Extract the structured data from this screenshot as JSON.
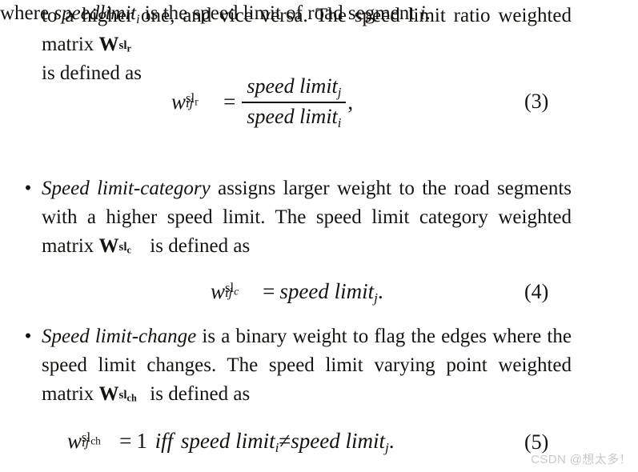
{
  "document": {
    "type": "academic-paper-excerpt",
    "background_color": "#ffffff",
    "text_color": "#15130f"
  },
  "intro_paragraph": {
    "line1": "to a higher one, and vice versa. The speed limit ratio",
    "line2_prefix": "weighted matrix ",
    "matrix_symbol": "W",
    "matrix_superscript": "sl",
    "matrix_subscript": "r",
    "line2_suffix": " is defined as",
    "full_text": "to a higher one, and vice versa. The speed limit ratio weighted matrix W^sl_r is defined as"
  },
  "equation3": {
    "lhs_base": "w",
    "lhs_sub": "ij",
    "lhs_sup": "sl",
    "lhs_sup_sub": "r",
    "operator": "=",
    "numerator": "speed limit",
    "numerator_sub": "j",
    "denominator": "speed limit",
    "denominator_sub": "i",
    "trailing_punctuation": ",",
    "number": "(3)",
    "latex": "w_{ij}^{sl_r} = \\frac{speed\\ limit_j}{speed\\ limit_i},"
  },
  "where_line": {
    "prefix": "where ",
    "term": "speedlimit",
    "term_sub": "i",
    "middle": " is the speed limit of road segment ",
    "variable": "i",
    "suffix": ".",
    "full_text": "where speedlimit_i is the speed limit of road segment i."
  },
  "bullets": [
    {
      "marker": "•",
      "emphasis": "Speed limit-category",
      "text_before_matrix": " assigns larger weight to the road segments with a higher speed limit. The speed limit category weighted matrix ",
      "matrix_symbol": "W",
      "matrix_superscript": "sl",
      "matrix_subscript": "c",
      "text_after_matrix": " is defined as",
      "full_text": "Speed limit-category assigns larger weight to the road segments with a higher speed limit. The speed limit category weighted matrix W^sl_c is defined as"
    },
    {
      "marker": "•",
      "emphasis": "Speed limit-change",
      "text_before_matrix": " is a binary weight to flag the edges where the speed limit changes. The speed limit varying point weighted matrix ",
      "matrix_symbol": "W",
      "matrix_superscript": "sl",
      "matrix_subscript": "ch",
      "text_after_matrix": " is defined as",
      "full_text": "Speed limit-change is a binary weight to flag the edges where the speed limit changes. The speed limit varying point weighted matrix W^sl_ch is defined as"
    }
  ],
  "equation4": {
    "lhs_base": "w",
    "lhs_sub": "ij",
    "lhs_sup": "sl",
    "lhs_sup_sub": "c",
    "operator": "=",
    "rhs": "speed limit",
    "rhs_sub": "j",
    "trailing_punctuation": ".",
    "number": "(4)",
    "latex": "w_{ij}^{sl_c} = speed\\ limit_j."
  },
  "equation5": {
    "lhs_base": "w",
    "lhs_sub": "ij",
    "lhs_sup": "sl",
    "lhs_sup_sub": "ch",
    "operator": "=",
    "value": "1",
    "condition": "iff",
    "term1": "speed limit",
    "term1_sub": "i",
    "relation": "≠",
    "term2": "speed limit",
    "term2_sub": "j",
    "trailing_punctuation": ".",
    "number": "(5)",
    "latex": "w_{ij}^{sl_{ch}} = 1\\ iff\\ speed\\ limit_i \\neq speed\\ limit_j."
  },
  "watermark": {
    "text": "CSDN @想太多！",
    "color": "#c8c8c8"
  }
}
